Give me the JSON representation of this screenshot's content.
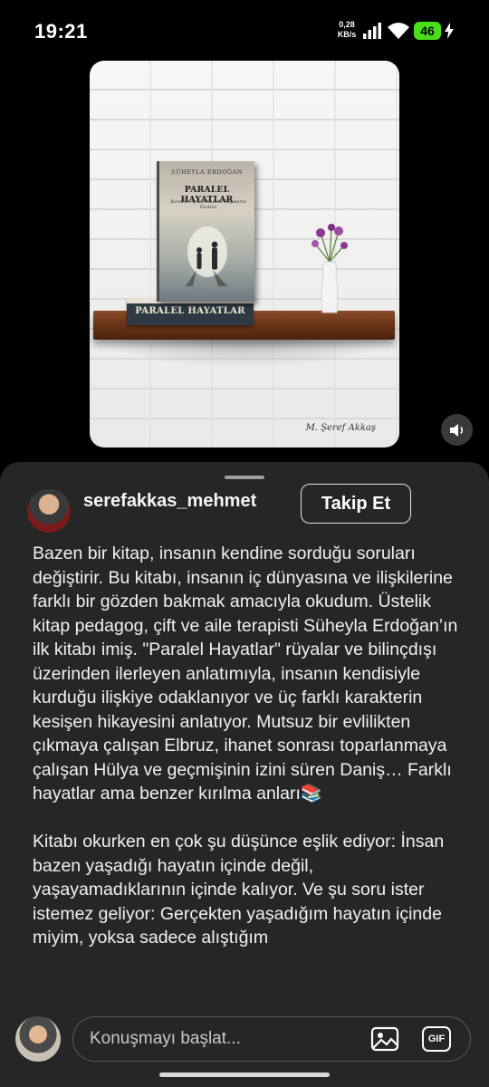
{
  "status_bar": {
    "time": "19:21",
    "net_speed_value": "0,28",
    "net_speed_unit": "KB/s",
    "battery": "46",
    "battery_color": "#4ade1d"
  },
  "media": {
    "book_author": "SÜHEYLA ERDOĞAN",
    "book_title": "PARALEL HAYATLAR",
    "book_subtitle": "Kendine Açılan Kapıda Rüyaların Fısıltısı",
    "spine_title": "PARALEL HAYATLAR",
    "signature": "M. Şeref Akkaş",
    "sound_icon": "volume-icon"
  },
  "post": {
    "username": "serefakkas_mehmet",
    "follow_label": "Takip Et",
    "caption": "Bazen bir kitap, insanın kendine sorduğu soruları değiştirir. Bu kitabı, insanın iç dünyasına ve ilişkilerine farklı bir gözden bakmak amacıyla okudum. Üstelik kitap pedagog, çift ve aile terapisti Süheyla Erdoğan’ın ilk kitabı imiş. \"Paralel Hayatlar\" rüyalar ve bilinçdışı üzerinden ilerleyen anlatımıyla, insanın kendisiyle kurduğu ilişkiye odaklanıyor ve üç farklı karakterin kesişen hikayesini anlatıyor. Mutsuz bir evlilikten çıkmaya çalışan Elbruz, ihanet sonrası toparlanmaya çalışan Hülya ve geçmişinin izini süren Daniş… Farklı hayatlar ama benzer kırılma anları📚\n\nKitabı okurken en çok şu düşünce eşlik ediyor: İnsan bazen yaşadığı hayatın içinde değil, yaşayamadıklarının içinde kalıyor. Ve şu soru ister istemez geliyor: Gerçekten yaşadığım hayatın içinde miyim, yoksa sadece alıştığım"
  },
  "composer": {
    "placeholder": "Konuşmayı başlat...",
    "gif_label": "GIF"
  }
}
